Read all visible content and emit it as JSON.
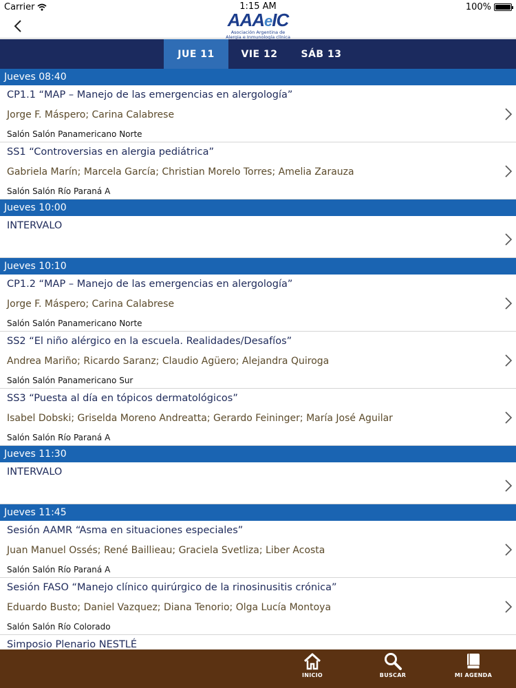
{
  "status_bar": {
    "carrier": "Carrier",
    "time": "1:15 AM",
    "battery": "100%"
  },
  "header": {
    "logo_text": "AAA",
    "logo_e": "e",
    "logo_ic": "IC",
    "logo_sub1": "Asociación Argentina de",
    "logo_sub2": "Alergia e Inmunología clínica"
  },
  "day_tabs": [
    {
      "label": "JUE 11",
      "active": true
    },
    {
      "label": "VIE 12",
      "active": false
    },
    {
      "label": "SÁB 13",
      "active": false
    }
  ],
  "schedule": [
    {
      "time": "Jueves 08:40",
      "sessions": [
        {
          "title": "CP1.1 “MAP – Manejo de las emergencias en alergología”",
          "speakers": "Jorge F. Máspero; Carina Calabrese",
          "room": "Salón Salón Panamericano Norte"
        },
        {
          "title": "SS1 “Controversias en alergia pediátrica”",
          "speakers": "Gabriela Marín; Marcela García; Christian Morelo Torres; Amelia Zarauza",
          "room": "Salón Salón Río Paraná A"
        }
      ]
    },
    {
      "time": "Jueves 10:00",
      "sessions": [
        {
          "title": "INTERVALO",
          "speakers": "",
          "room": ""
        }
      ]
    },
    {
      "time": "Jueves 10:10",
      "sessions": [
        {
          "title": "CP1.2 “MAP – Manejo de las emergencias en alergología”",
          "speakers": "Jorge F. Máspero; Carina Calabrese",
          "room": "Salón Salón Panamericano Norte"
        },
        {
          "title": "SS2 “El niño alérgico en la escuela. Realidades/Desafíos”",
          "speakers": "Andrea Mariño; Ricardo Saranz; Claudio Agüero; Alejandra Quiroga",
          "room": "Salón Salón Panamericano Sur"
        },
        {
          "title": "SS3 “Puesta al día en tópicos dermatológicos”",
          "speakers": "Isabel Dobski; Griselda Moreno Andreatta; Gerardo Feininger; María José Aguilar",
          "room": "Salón Salón Río Paraná A"
        }
      ]
    },
    {
      "time": "Jueves 11:30",
      "sessions": [
        {
          "title": "INTERVALO",
          "speakers": "",
          "room": ""
        }
      ]
    },
    {
      "time": "Jueves 11:45",
      "sessions": [
        {
          "title": "Sesión AAMR “Asma en situaciones especiales”",
          "speakers": "Juan Manuel Ossés; René Baillieau; Graciela Svetliza; Liber Acosta",
          "room": "Salón Salón Río Paraná A"
        },
        {
          "title": "Sesión FASO “Manejo clínico quirúrgico de la rinosinusitis crónica”",
          "speakers": "Eduardo Busto; Daniel Vazquez; Diana Tenorio; Olga Lucía Montoya",
          "room": "Salón Salón Río Colorado"
        },
        {
          "title": "Simposio Plenario NESTLÉ",
          "speakers": "",
          "room": ""
        }
      ]
    }
  ],
  "tab_bar": {
    "inicio": {
      "label": "INICIO",
      "icon": "home-icon"
    },
    "buscar": {
      "label": "BUSCAR",
      "icon": "search-icon"
    },
    "agenda": {
      "label": "MI AGENDA",
      "icon": "book-icon"
    }
  },
  "colors": {
    "tabs_bg": "#1b2a5e",
    "tab_active": "#2f6db5",
    "time_header": "#1a64b2",
    "tab_bar_bg": "#5b3212",
    "title_text": "#1e2a5a",
    "speaker_text": "#5b4a2a"
  }
}
